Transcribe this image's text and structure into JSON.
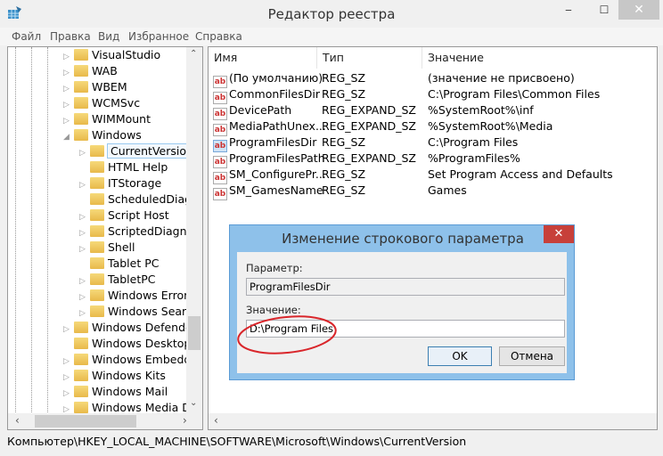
{
  "window": {
    "title": "Редактор реестра",
    "minimize": "‒",
    "maximize": "☐",
    "close": "✕"
  },
  "menu": [
    "Файл",
    "Правка",
    "Вид",
    "Избранное",
    "Справка"
  ],
  "tree": [
    {
      "label": "VisualStudio",
      "level": 0,
      "exp": "collapsed"
    },
    {
      "label": "WAB",
      "level": 0,
      "exp": "collapsed"
    },
    {
      "label": "WBEM",
      "level": 0,
      "exp": "collapsed"
    },
    {
      "label": "WCMSvc",
      "level": 0,
      "exp": "collapsed"
    },
    {
      "label": "WIMMount",
      "level": 0,
      "exp": "collapsed"
    },
    {
      "label": "Windows",
      "level": 0,
      "exp": "expanded"
    },
    {
      "label": "CurrentVersion",
      "level": 1,
      "exp": "collapsed",
      "selected": true
    },
    {
      "label": "HTML Help",
      "level": 1,
      "exp": "none"
    },
    {
      "label": "ITStorage",
      "level": 1,
      "exp": "collapsed"
    },
    {
      "label": "ScheduledDiagn",
      "level": 1,
      "exp": "none"
    },
    {
      "label": "Script Host",
      "level": 1,
      "exp": "collapsed"
    },
    {
      "label": "ScriptedDiagnos",
      "level": 1,
      "exp": "collapsed"
    },
    {
      "label": "Shell",
      "level": 1,
      "exp": "collapsed"
    },
    {
      "label": "Tablet PC",
      "level": 1,
      "exp": "none"
    },
    {
      "label": "TabletPC",
      "level": 1,
      "exp": "collapsed"
    },
    {
      "label": "Windows Error R",
      "level": 1,
      "exp": "collapsed"
    },
    {
      "label": "Windows Search",
      "level": 1,
      "exp": "collapsed"
    },
    {
      "label": "Windows Defender",
      "level": 0,
      "exp": "collapsed"
    },
    {
      "label": "Windows Desktop S",
      "level": 0,
      "exp": "none"
    },
    {
      "label": "Windows Embedded",
      "level": 0,
      "exp": "collapsed"
    },
    {
      "label": "Windows Kits",
      "level": 0,
      "exp": "collapsed"
    },
    {
      "label": "Windows Mail",
      "level": 0,
      "exp": "collapsed"
    },
    {
      "label": "Windows Media Dev",
      "level": 0,
      "exp": "collapsed"
    }
  ],
  "list": {
    "columns": [
      "Имя",
      "Тип",
      "Значение"
    ],
    "rows": [
      {
        "name": "(По умолчанию)",
        "type": "REG_SZ",
        "value": "(значение не присвоено)"
      },
      {
        "name": "CommonFilesDir",
        "type": "REG_SZ",
        "value": "C:\\Program Files\\Common Files"
      },
      {
        "name": "DevicePath",
        "type": "REG_EXPAND_SZ",
        "value": "%SystemRoot%\\inf"
      },
      {
        "name": "MediaPathUnex...",
        "type": "REG_EXPAND_SZ",
        "value": "%SystemRoot%\\Media"
      },
      {
        "name": "ProgramFilesDir",
        "type": "REG_SZ",
        "value": "C:\\Program Files",
        "highlighted": true
      },
      {
        "name": "ProgramFilesPath",
        "type": "REG_EXPAND_SZ",
        "value": "%ProgramFiles%"
      },
      {
        "name": "SM_ConfigurePr...",
        "type": "REG_SZ",
        "value": "Set Program Access and Defaults"
      },
      {
        "name": "SM_GamesName",
        "type": "REG_SZ",
        "value": "Games"
      }
    ]
  },
  "status": "Компьютер\\HKEY_LOCAL_MACHINE\\SOFTWARE\\Microsoft\\Windows\\CurrentVersion",
  "dialog": {
    "title": "Изменение строкового параметра",
    "close": "✕",
    "param_label": "Параметр:",
    "param_value": "ProgramFilesDir",
    "value_label": "Значение:",
    "value": "D:\\Program Files",
    "ok": "OK",
    "cancel": "Отмена"
  },
  "colors": {
    "annotation": "#d9262b",
    "dialog_frame": "#8ec1ea"
  }
}
